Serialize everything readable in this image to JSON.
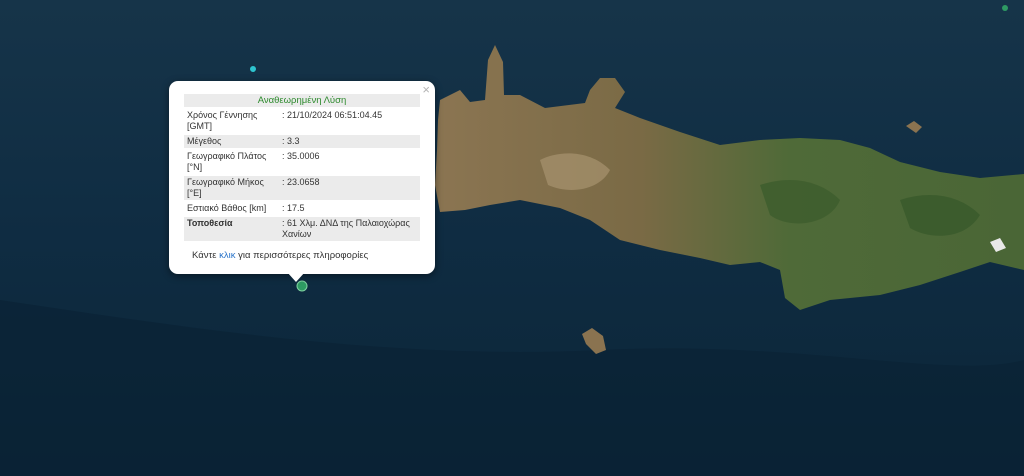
{
  "popup": {
    "title": "Αναθεωρημένη Λύση",
    "close_label": "×",
    "rows": [
      {
        "label": "Χρόνος Γέννησης [GMT]",
        "value": ": 21/10/2024 06:51:04.45"
      },
      {
        "label": "Μέγεθος",
        "value": ": 3.3"
      },
      {
        "label": "Γεωγραφικό Πλάτος [°N]",
        "value": ": 35.0006"
      },
      {
        "label": "Γεωγραφικό Μήκος [°E]",
        "value": ": 23.0658"
      },
      {
        "label": "Εστιακό Βάθος [km]",
        "value": ": 17.5"
      },
      {
        "label": "Τοποθεσία",
        "value": ": 61 Χλμ. ΔΝΔ της Παλαιοχώρας Χανίων"
      }
    ],
    "more_prefix": "Κάντε ",
    "more_link": "κλικ",
    "more_suffix": " για περισσότερες πληροφορίες"
  },
  "colors": {
    "sea": "#0e2a3f",
    "land_green": "#4a6a36",
    "land_brown": "#8a7350",
    "event_marker": "#2e9a63",
    "other_marker": "#2ec4cf"
  }
}
